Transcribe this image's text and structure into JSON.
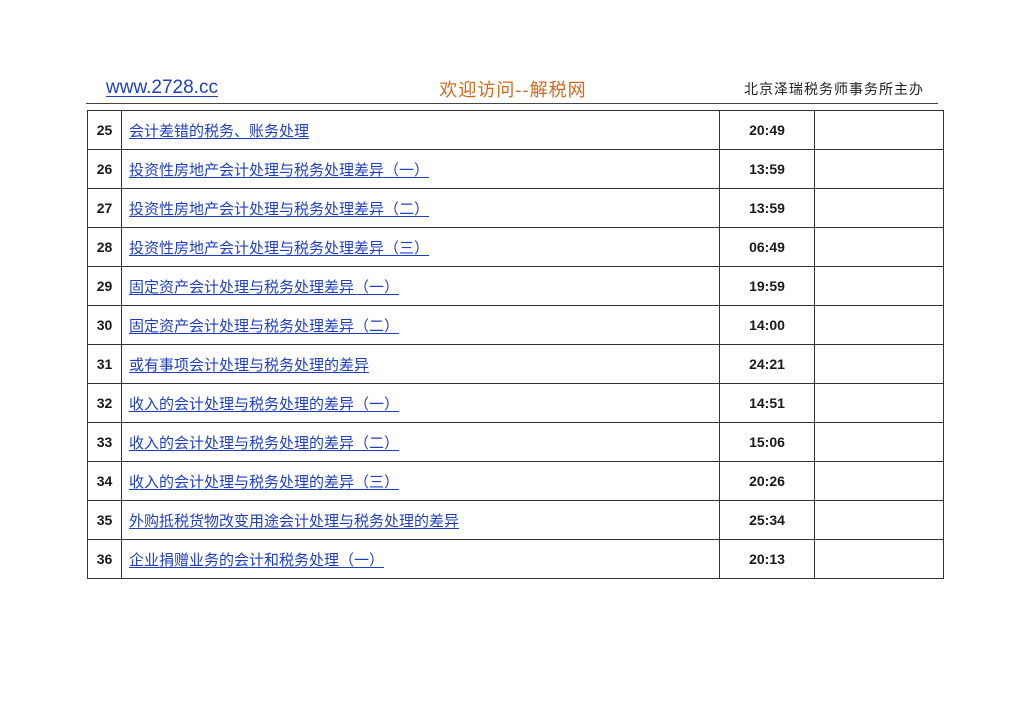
{
  "header": {
    "site": "www.2728.cc",
    "welcome": "欢迎访问--解税网",
    "sponsor": "北京泽瑞税务师事务所主办"
  },
  "rows": [
    {
      "num": "25",
      "title": "会计差错的税务、账务处理",
      "duration": "20:49"
    },
    {
      "num": "26",
      "title": "投资性房地产会计处理与税务处理差异（一）",
      "duration": "13:59"
    },
    {
      "num": "27",
      "title": "投资性房地产会计处理与税务处理差异（二）",
      "duration": "13:59"
    },
    {
      "num": "28",
      "title": "投资性房地产会计处理与税务处理差异（三）",
      "duration": "06:49"
    },
    {
      "num": "29",
      "title": "固定资产会计处理与税务处理差异（一）",
      "duration": "19:59"
    },
    {
      "num": "30",
      "title": "固定资产会计处理与税务处理差异（二）",
      "duration": "14:00"
    },
    {
      "num": "31",
      "title": "或有事项会计处理与税务处理的差异",
      "duration": "24:21"
    },
    {
      "num": "32",
      "title": "收入的会计处理与税务处理的差异（一）",
      "duration": "14:51"
    },
    {
      "num": "33",
      "title": "收入的会计处理与税务处理的差异（二）",
      "duration": "15:06"
    },
    {
      "num": "34",
      "title": "收入的会计处理与税务处理的差异（三）",
      "duration": "20:26"
    },
    {
      "num": "35",
      "title": "外购抵税货物改变用途会计处理与税务处理的差异",
      "duration": "25:34"
    },
    {
      "num": "36",
      "title": "企业捐赠业务的会计和税务处理（一）",
      "duration": "20:13"
    }
  ]
}
